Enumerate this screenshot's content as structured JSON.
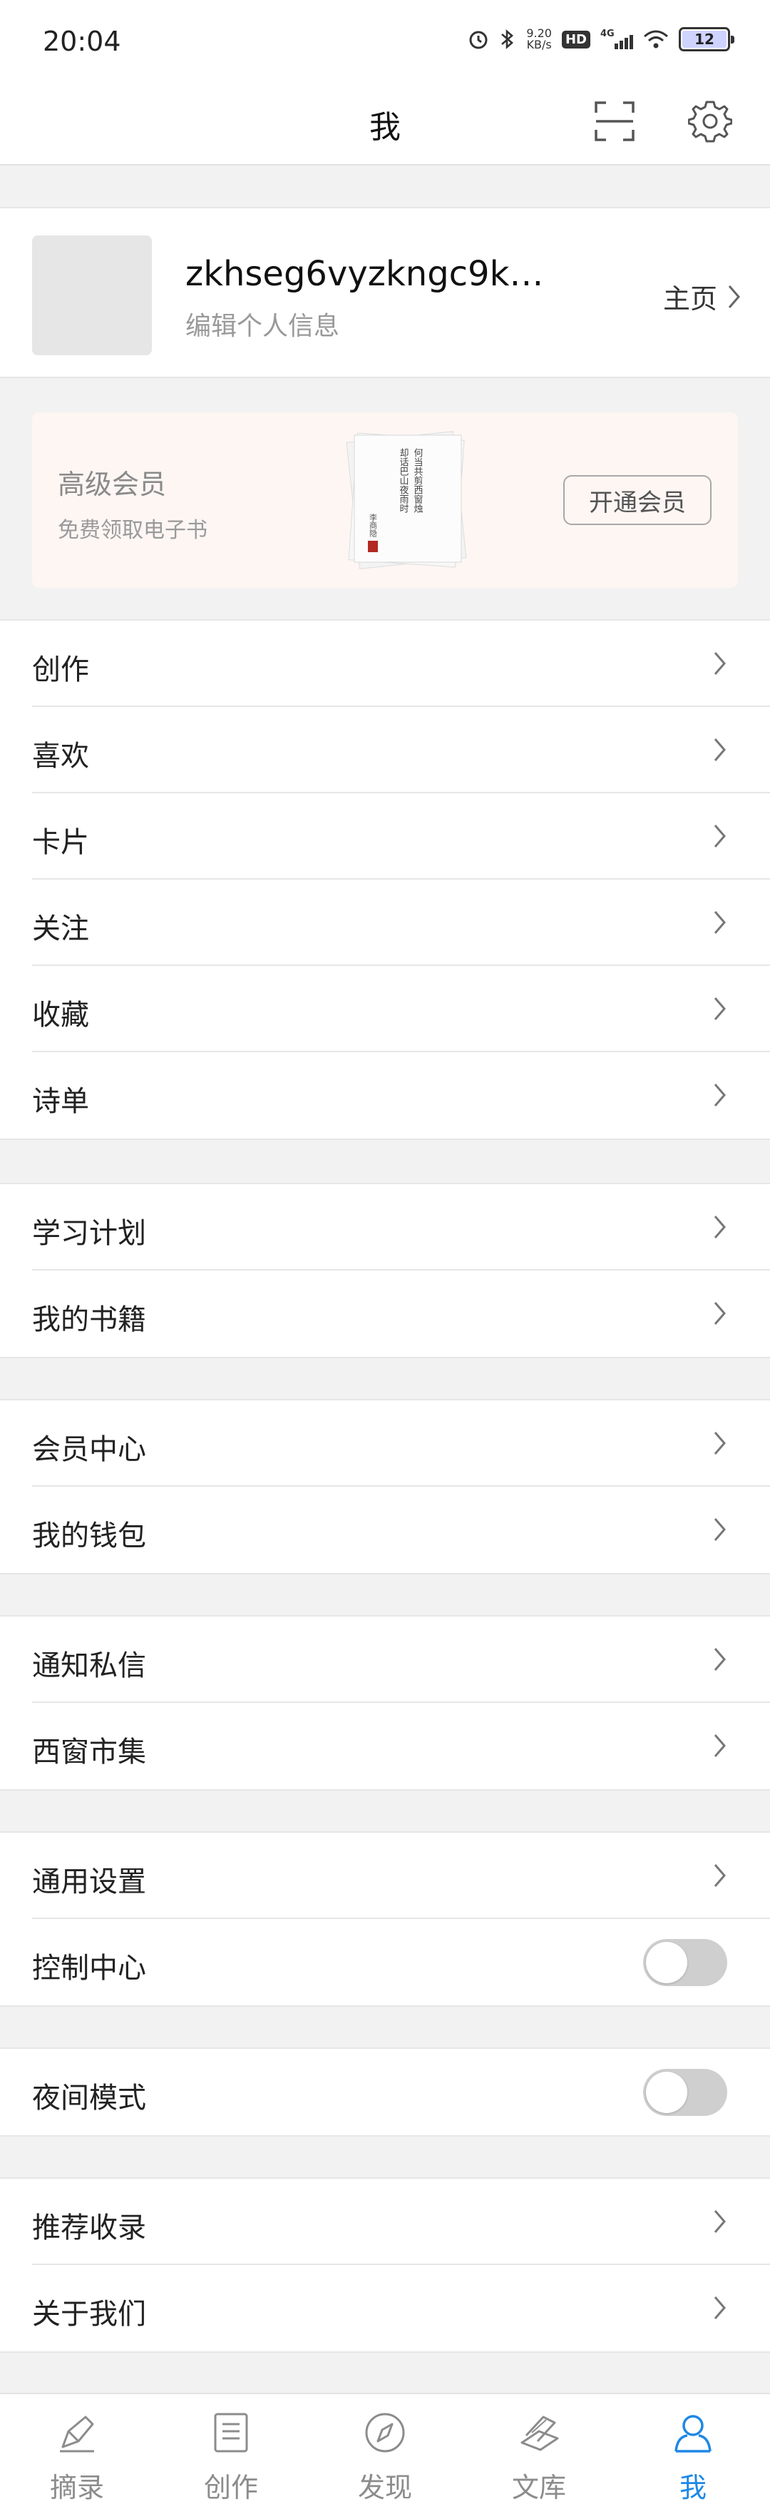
{
  "status_bar": {
    "time": "20:04",
    "net_speed_value": "9.20",
    "net_speed_unit": "KB/s",
    "hd": "HD",
    "network": "4G",
    "battery": "12"
  },
  "header": {
    "title": "我",
    "scan_icon": "scan-icon",
    "settings_icon": "gear-icon"
  },
  "profile": {
    "username": "zkhseg6vyzkngc9k…",
    "edit_info": "编辑个人信息",
    "homepage_label": "主页"
  },
  "vip": {
    "title": "高级会员",
    "subtitle": "免费领取电子书",
    "button": "开通会员",
    "book_poem_lines": [
      "何当共剪西窗烛",
      "却话巴山夜雨时"
    ],
    "book_author": "李商隐",
    "book_seal_color": "#b22a22"
  },
  "groups": [
    {
      "items": [
        {
          "label": "创作",
          "type": "link"
        },
        {
          "label": "喜欢",
          "type": "link"
        },
        {
          "label": "卡片",
          "type": "link"
        },
        {
          "label": "关注",
          "type": "link"
        },
        {
          "label": "收藏",
          "type": "link"
        },
        {
          "label": "诗单",
          "type": "link"
        }
      ]
    },
    {
      "items": [
        {
          "label": "学习计划",
          "type": "link"
        },
        {
          "label": "我的书籍",
          "type": "link"
        }
      ]
    },
    {
      "items": [
        {
          "label": "会员中心",
          "type": "link"
        },
        {
          "label": "我的钱包",
          "type": "link"
        }
      ]
    },
    {
      "items": [
        {
          "label": "通知私信",
          "type": "link"
        },
        {
          "label": "西窗市集",
          "type": "link"
        }
      ]
    },
    {
      "items": [
        {
          "label": "通用设置",
          "type": "link"
        },
        {
          "label": "控制中心",
          "type": "toggle",
          "on": false
        }
      ]
    },
    {
      "items": [
        {
          "label": "夜间模式",
          "type": "toggle",
          "on": false
        }
      ]
    },
    {
      "items": [
        {
          "label": "推荐收录",
          "type": "link"
        },
        {
          "label": "关于我们",
          "type": "link"
        }
      ]
    }
  ],
  "tabbar": {
    "tabs": [
      {
        "label": "摘录",
        "icon": "pen-icon",
        "active": false
      },
      {
        "label": "创作",
        "icon": "document-icon",
        "active": false
      },
      {
        "label": "发现",
        "icon": "compass-icon",
        "active": false
      },
      {
        "label": "文库",
        "icon": "books-icon",
        "active": false
      },
      {
        "label": "我",
        "icon": "user-icon",
        "active": true
      }
    ]
  },
  "colors": {
    "accent": "#1e88e5",
    "inactive": "#8c8c8c",
    "background": "#f2f2f2",
    "vip_card": "#fdf6f3"
  }
}
